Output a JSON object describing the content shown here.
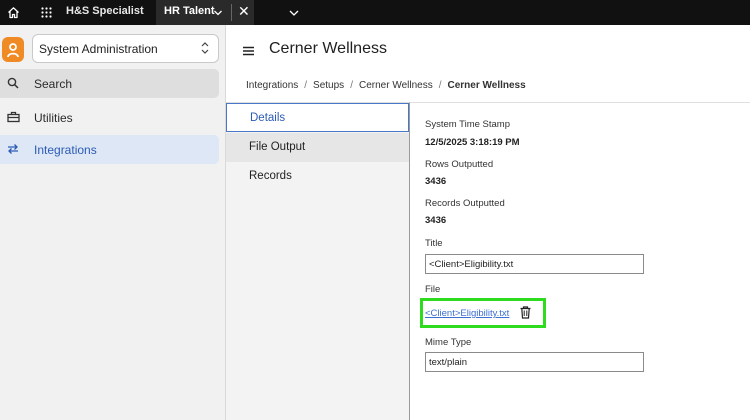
{
  "topbar": {
    "home_icon": "home-icon",
    "grid_icon": "apps-grid-icon",
    "app_name": "H&S Specialist",
    "tab_label": "HR Talent",
    "tab_close": "✕",
    "more_icon": "chevron-down-icon"
  },
  "sidebar": {
    "context_select": "System Administration",
    "items": [
      {
        "label": "Search",
        "icon": "search-icon"
      },
      {
        "label": "Utilities",
        "icon": "toolbox-icon"
      },
      {
        "label": "Integrations",
        "icon": "swap-arrows-icon"
      }
    ]
  },
  "main": {
    "title": "Cerner Wellness",
    "breadcrumb": [
      "Integrations",
      "Setups",
      "Cerner Wellness",
      "Cerner Wellness"
    ],
    "breadcrumb_separator": "/",
    "subnav": [
      "Details",
      "File Output",
      "Records"
    ]
  },
  "details": {
    "timestamp_label": "System Time Stamp",
    "timestamp_value": "12/5/2025 3:18:19 PM",
    "rows_label": "Rows Outputted",
    "rows_value": "3436",
    "records_label": "Records Outputted",
    "records_value": "3436",
    "title_label": "Title",
    "title_value": "<Client>Eligibility.txt",
    "file_label": "File",
    "file_link": "<Client>Eligibility.txt",
    "mime_label": "Mime Type",
    "mime_value": "text/plain"
  },
  "colors": {
    "accent": "#2c5bb5",
    "highlight": "#2edb1f",
    "logo": "#f08a24",
    "topbar": "#111111"
  }
}
